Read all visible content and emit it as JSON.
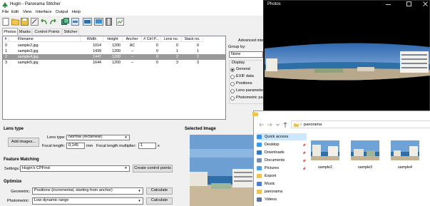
{
  "hugin": {
    "title": "Hugin - Panorama Stitcher",
    "menu": [
      "File",
      "Edit",
      "View",
      "Interface",
      "Output",
      "Help"
    ],
    "tabs": [
      "Photos",
      "Masks",
      "Control Points",
      "Stitcher"
    ],
    "table": {
      "headers": [
        "#",
        "Filename",
        "Width",
        "Height",
        "Anchor",
        "# Ctrl P...",
        "Lens no.",
        "Stack no."
      ],
      "rows": [
        {
          "num": "0",
          "filename": "sample2.jpg",
          "width": "1014",
          "height": "1200",
          "anchor": "AC",
          "ctrl": "0",
          "lens": "0",
          "stack": "0",
          "selected": false
        },
        {
          "num": "1",
          "filename": "sample3.jpg",
          "width": "1439",
          "height": "1200",
          "anchor": "--",
          "ctrl": "0",
          "lens": "1",
          "stack": "1",
          "selected": false
        },
        {
          "num": "2",
          "filename": "sample4.jpg",
          "width": "1447",
          "height": "1200",
          "anchor": "--",
          "ctrl": "0",
          "lens": "2",
          "stack": "2",
          "selected": true
        },
        {
          "num": "3",
          "filename": "sample5.jpg",
          "width": "1644",
          "height": "1200",
          "anchor": "--",
          "ctrl": "0",
          "lens": "3",
          "stack": "3",
          "selected": false
        }
      ]
    },
    "right_panel": {
      "advanced": "Advanced inte",
      "group_by_label": "Group by:",
      "group_by_value": "None",
      "display_label": "Display",
      "display_options": [
        "General",
        "EXIF data",
        "Positions",
        "Lens parameters",
        "Photometric para"
      ],
      "display_selected": 0
    },
    "lens_type": {
      "title": "Lens type",
      "add_images": "Add images...",
      "lens_type_label": "Lens type:",
      "lens_type_value": "Normal (rectilinear)",
      "focal_length_label": "Focal length:",
      "focal_length_value": "0,145",
      "focal_length_unit": "mm",
      "multiplier_label": "Focal length multiplier:",
      "multiplier_value": "1",
      "multiplier_unit": "x"
    },
    "feature_matching": {
      "title": "Feature Matching",
      "settings_label": "Settings:",
      "settings_value": "Hugin's CPFind",
      "create_button": "Create control points"
    },
    "optimize": {
      "title": "Optimize",
      "geometric_label": "Geometric:",
      "geometric_value": "Positions (incremental, starting from anchor)",
      "geometric_button": "Calculate",
      "photometric_label": "Photometric:",
      "photometric_value": "Low dynamic range",
      "photometric_button": "Calculate"
    },
    "selected_image_title": "Selected Image"
  },
  "photos_window": {
    "title": "Photos"
  },
  "explorer": {
    "path": "panorama",
    "nav": [
      {
        "label": "Quick access",
        "icon": "star-icon",
        "color": "#3c8ee6"
      },
      {
        "label": "Desktop",
        "icon": "desktop-icon",
        "color": "#3a9be8"
      },
      {
        "label": "Downloads",
        "icon": "download-icon",
        "color": "#2f78c4"
      },
      {
        "label": "Documents",
        "icon": "document-icon",
        "color": "#7c8fa8"
      },
      {
        "label": "Pictures",
        "icon": "pictures-icon",
        "color": "#4aa0e0"
      },
      {
        "label": "Export",
        "icon": "folder-icon",
        "color": "#f2c24e"
      },
      {
        "label": "Music",
        "icon": "music-icon",
        "color": "#4a7bd6"
      },
      {
        "label": "panorama",
        "icon": "folder-icon",
        "color": "#f2c24e"
      },
      {
        "label": "Videos",
        "icon": "video-icon",
        "color": "#5b6fa8"
      }
    ],
    "files": [
      "sample2",
      "sample3",
      "sample4"
    ]
  },
  "colors": {
    "selection_row": "#9a9a9a",
    "quick_access_highlight": "#cce8ff",
    "sky": "#5f92c9",
    "sea": "#2f6fa8"
  }
}
